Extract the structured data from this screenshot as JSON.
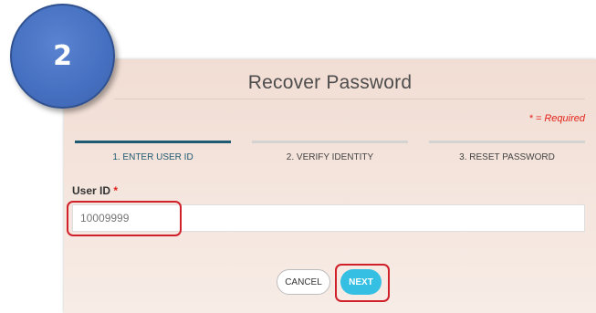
{
  "step_badge": {
    "number": "2",
    "color": "#456fc0"
  },
  "form": {
    "title": "Recover Password",
    "required_note": "* = Required",
    "steps": [
      {
        "label": "1. ENTER USER ID",
        "active": true
      },
      {
        "label": "2. VERIFY IDENTITY",
        "active": false
      },
      {
        "label": "3. RESET PASSWORD",
        "active": false
      }
    ],
    "user_id_label": "User ID",
    "required_marker": "*",
    "user_id_value": "10009999",
    "cancel_label": "CANCEL",
    "next_label": "NEXT"
  },
  "colors": {
    "active_step": "#1f5a73",
    "next_button": "#35bfe3",
    "highlight": "#d0202a",
    "required": "#e2231a"
  }
}
